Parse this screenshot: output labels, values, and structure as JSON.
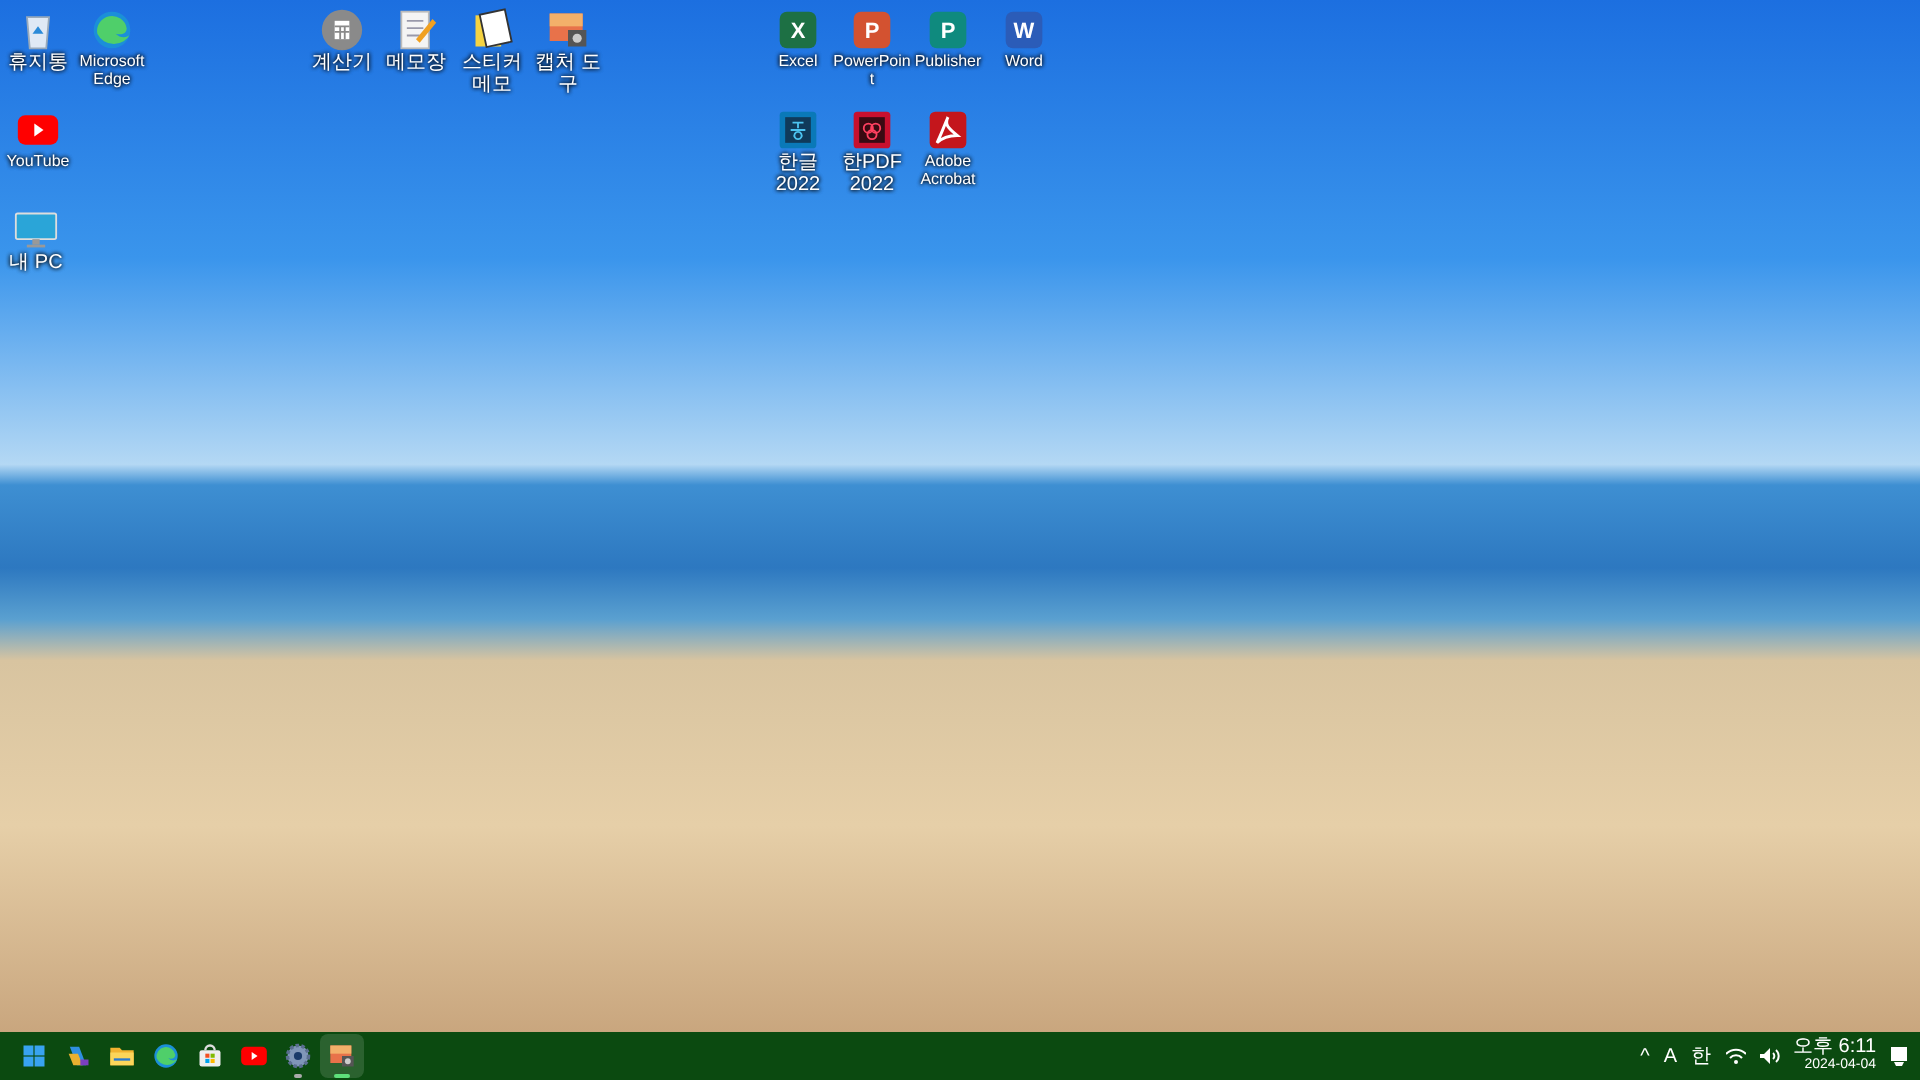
{
  "desktop_icons": [
    {
      "kind": "recycle",
      "label": "휴지통"
    },
    {
      "kind": "edge",
      "label": "Microsoft Edge"
    },
    {
      "kind": "calculator",
      "label": "계산기"
    },
    {
      "kind": "notepad",
      "label": "메모장"
    },
    {
      "kind": "sticky",
      "label": "스티커 메모"
    },
    {
      "kind": "snip",
      "label": "캡처 도구"
    },
    {
      "kind": "office",
      "glyph": "X",
      "color": "#1d7044",
      "label": "Excel"
    },
    {
      "kind": "office",
      "glyph": "P",
      "color": "#d35230",
      "label": "PowerPoint"
    },
    {
      "kind": "office",
      "glyph": "P",
      "color": "#0f8a7e",
      "label": "Publisher"
    },
    {
      "kind": "office",
      "glyph": "W",
      "color": "#2b5cb8",
      "label": "Word"
    },
    {
      "kind": "youtube",
      "label": "YouTube"
    },
    {
      "kind": "hangul",
      "label": "한글 2022"
    },
    {
      "kind": "hanpdf",
      "label": "한PDF 2022"
    },
    {
      "kind": "acrobat",
      "label": "Adobe Acrobat"
    },
    {
      "kind": "pc",
      "label": "내 PC"
    }
  ],
  "taskbar": {
    "apps": [
      {
        "kind": "start",
        "running": false,
        "selected": false
      },
      {
        "kind": "copilot",
        "running": false,
        "selected": false
      },
      {
        "kind": "folder",
        "running": false,
        "selected": false
      },
      {
        "kind": "edge",
        "running": false,
        "selected": false
      },
      {
        "kind": "store",
        "running": false,
        "selected": false
      },
      {
        "kind": "youtube",
        "running": false,
        "selected": false
      },
      {
        "kind": "settings",
        "running": true,
        "selected": false
      },
      {
        "kind": "snip",
        "running": true,
        "selected": true
      }
    ],
    "tray": {
      "overflow": "^",
      "language": "A",
      "ime": "한",
      "time": "오후 6:11",
      "date": "2024-04-04"
    }
  }
}
